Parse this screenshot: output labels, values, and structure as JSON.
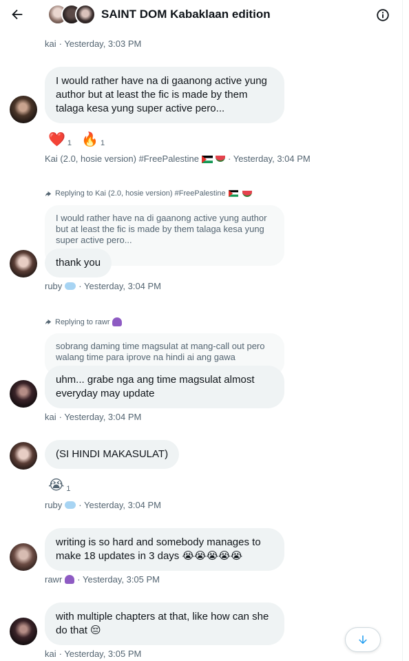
{
  "header": {
    "title": "SAINT DOM Kabaklaan edition"
  },
  "messages": [
    {
      "id": "m0",
      "meta": {
        "sender": "kai",
        "time": "· Yesterday, 3:03 PM"
      }
    },
    {
      "id": "m1",
      "text": "I would rather have na di gaanong active yung author but at least the fic is made by them talaga kesa yung super active pero...",
      "reactions": [
        {
          "emoji": "❤️",
          "count": "1",
          "icon": "heart-icon"
        },
        {
          "emoji": "🔥",
          "count": "1",
          "icon": "fire-icon"
        }
      ],
      "meta": {
        "sender": "Kai (2.0, hosie version) #FreePalestine",
        "time": "· Yesterday, 3:04 PM"
      }
    },
    {
      "id": "m2",
      "reply_label": "Replying to Kai (2.0, hosie version) #FreePalestine",
      "quote": "I would rather have na di gaanong active yung author but at least the fic is made by them talaga kesa yung super active pero...",
      "text": "thank you",
      "meta": {
        "sender": "ruby",
        "time": "· Yesterday, 3:04 PM"
      }
    },
    {
      "id": "m3",
      "reply_label": "Replying to rawr",
      "quote": "sobrang daming time magsulat at mang-call out pero walang time para iprove na hindi ai ang gawa",
      "text": "uhm... grabe nga ang time magsulat almost everyday may update",
      "meta": {
        "sender": "kai",
        "time": "· Yesterday, 3:04 PM"
      }
    },
    {
      "id": "m4",
      "text": "(SI HINDI MAKASULAT)",
      "reactions": [
        {
          "emoji": "😭",
          "count": "1",
          "icon": "crying-face-icon"
        }
      ],
      "meta": {
        "sender": "ruby",
        "time": "· Yesterday, 3:04 PM"
      }
    },
    {
      "id": "m5",
      "text": "writing is so hard and somebody manages to make 18 updates in 3 days",
      "text_emoji": "😭😭😭😭😭",
      "meta": {
        "sender": "rawr",
        "time": "· Yesterday, 3:05 PM"
      }
    },
    {
      "id": "m6",
      "text": "with multiple chapters at that, like how can she do that",
      "text_emoji": "😔",
      "meta": {
        "sender": "kai",
        "time": "· Yesterday, 3:05 PM"
      }
    }
  ],
  "colors": {
    "bubble": "#eff3f4",
    "quote": "#f7f9f9",
    "secondary_text": "#536471",
    "accent": "#1d9bf0"
  },
  "icons": {
    "back": "arrow-left-icon",
    "info": "info-icon",
    "scroll": "arrow-down-icon",
    "reply": "reply-arrow-icon"
  }
}
